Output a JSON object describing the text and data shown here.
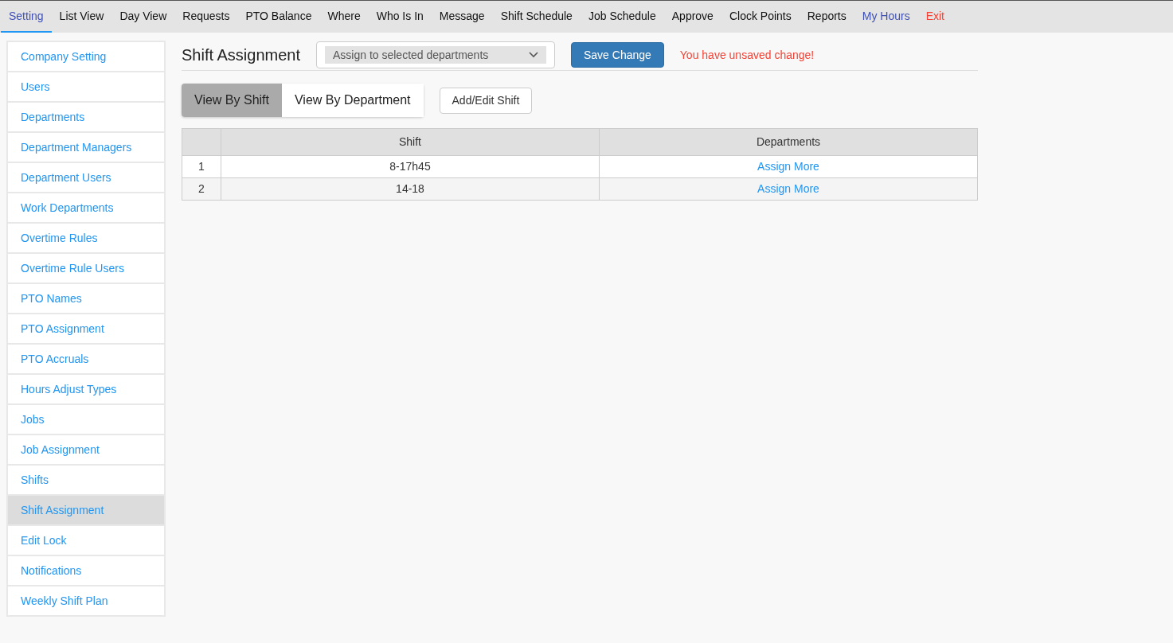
{
  "nav": [
    {
      "label": "Setting",
      "kind": "normal",
      "selected": true
    },
    {
      "label": "List View",
      "kind": "normal",
      "selected": false
    },
    {
      "label": "Day View",
      "kind": "normal",
      "selected": false
    },
    {
      "label": "Requests",
      "kind": "normal",
      "selected": false
    },
    {
      "label": "PTO Balance",
      "kind": "normal",
      "selected": false
    },
    {
      "label": "Where",
      "kind": "normal",
      "selected": false
    },
    {
      "label": "Who Is In",
      "kind": "normal",
      "selected": false
    },
    {
      "label": "Message",
      "kind": "normal",
      "selected": false
    },
    {
      "label": "Shift Schedule",
      "kind": "normal",
      "selected": false
    },
    {
      "label": "Job Schedule",
      "kind": "normal",
      "selected": false
    },
    {
      "label": "Approve",
      "kind": "normal",
      "selected": false
    },
    {
      "label": "Clock Points",
      "kind": "normal",
      "selected": false
    },
    {
      "label": "Reports",
      "kind": "normal",
      "selected": false
    },
    {
      "label": "My Hours",
      "kind": "account",
      "selected": false
    },
    {
      "label": "Exit",
      "kind": "exit",
      "selected": false
    }
  ],
  "sidebar": {
    "items": [
      {
        "label": "Company Setting",
        "selected": false
      },
      {
        "label": "Users",
        "selected": false
      },
      {
        "label": "Departments",
        "selected": false
      },
      {
        "label": "Department Managers",
        "selected": false
      },
      {
        "label": "Department Users",
        "selected": false
      },
      {
        "label": "Work Departments",
        "selected": false
      },
      {
        "label": "Overtime Rules",
        "selected": false
      },
      {
        "label": "Overtime Rule Users",
        "selected": false
      },
      {
        "label": "PTO Names",
        "selected": false
      },
      {
        "label": "PTO Assignment",
        "selected": false
      },
      {
        "label": "PTO Accruals",
        "selected": false
      },
      {
        "label": "Hours Adjust Types",
        "selected": false
      },
      {
        "label": "Jobs",
        "selected": false
      },
      {
        "label": "Job Assignment",
        "selected": false
      },
      {
        "label": "Shifts",
        "selected": false
      },
      {
        "label": "Shift Assignment",
        "selected": true
      },
      {
        "label": "Edit Lock",
        "selected": false
      },
      {
        "label": "Notifications",
        "selected": false
      },
      {
        "label": "Weekly Shift Plan",
        "selected": false
      }
    ]
  },
  "header": {
    "title": "Shift Assignment",
    "mode_select": "Assign to selected departments",
    "save_button": "Save Change",
    "warning": "You have unsaved change!"
  },
  "view_tabs": [
    {
      "label": "View By Shift",
      "selected": true
    },
    {
      "label": "View By Department",
      "selected": false
    }
  ],
  "add_edit_button": "Add/Edit Shift",
  "table": {
    "columns": [
      "Shift",
      "Departments"
    ],
    "rows": [
      {
        "index": "1",
        "shift": "8-17h45",
        "action": "Assign More"
      },
      {
        "index": "2",
        "shift": "14-18",
        "action": "Assign More"
      }
    ]
  }
}
